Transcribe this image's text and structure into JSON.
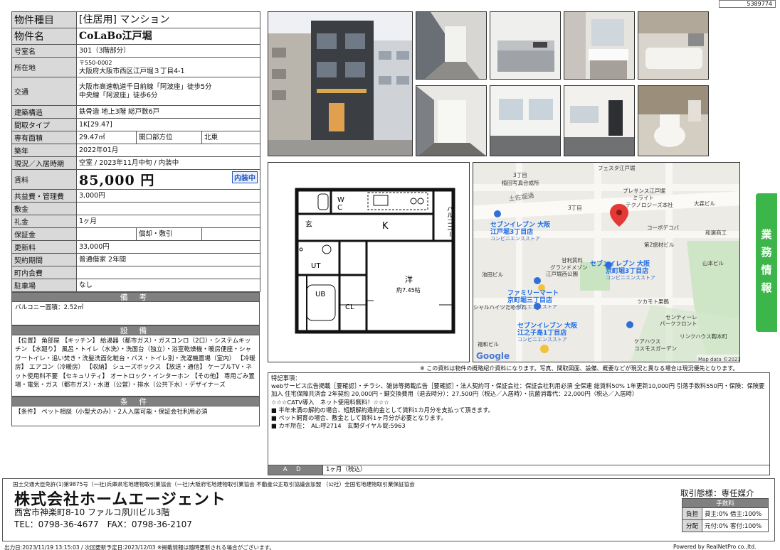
{
  "doc_id": "5389774",
  "spec": {
    "property_type": {
      "label": "物件種目",
      "value": "[住居用] マンション"
    },
    "property_name": {
      "label": "物件名",
      "value": "CoLaBo江戸堀"
    },
    "room_number": {
      "label": "号室名",
      "value": "301（3階部分）"
    },
    "location": {
      "label": "所在地",
      "postal": "〒550-0002",
      "value": "大阪府大阪市西区江戸堀３丁目4-1"
    },
    "transport": {
      "label": "交通",
      "line1": "大阪市高速軌道千日前線「阿波座」徒歩5分",
      "line2": "中央線「阿波座」徒歩6分"
    },
    "structure": {
      "label": "建築構造",
      "value": "鉄骨造 地上3階 総戸数6戸"
    },
    "layout_type": {
      "label": "間取タイプ",
      "value": "1K[29.47]"
    },
    "area": {
      "label": "専有面積",
      "value": "29.47㎡",
      "opening_label": "開口部方位",
      "opening_value": "北東"
    },
    "built": {
      "label": "築年",
      "value": "2022年01月"
    },
    "status": {
      "label": "現況／入居時期",
      "value": "空室 / 2023年11月中旬 / 内装中"
    },
    "rent": {
      "label": "賃料",
      "value": "85,000 円",
      "badge": "内装中"
    },
    "common_fee": {
      "label": "共益費・管理費",
      "value": "3,000円"
    },
    "deposit": {
      "label": "敷金",
      "value": ""
    },
    "key_money": {
      "label": "礼金",
      "value": "1ヶ月"
    },
    "guarantee": {
      "label": "保証金",
      "value": "",
      "shokyaku_label": "償却・敷引",
      "shokyaku_value": ""
    },
    "renewal": {
      "label": "更新料",
      "value": "33,000円"
    },
    "contract": {
      "label": "契約期間",
      "value": "普通借家 2年間"
    },
    "town_fee": {
      "label": "町内会費",
      "value": ""
    },
    "parking": {
      "label": "駐車場",
      "value": "なし"
    }
  },
  "notes": {
    "head": "備 考",
    "body": "バルコニー面積：2.52㎡"
  },
  "facilities": {
    "head": "設 備",
    "body": "【位置】 角部屋 【キッチン】 給湯器（都市ガス）・ガスコンロ（2口）・システムキッチン 【水廻り】 風呂・トイレ（水洗）・洗面台（独立）・浴室乾燥機・暖房便座・シャワートイレ・追い焚き・洗髪洗面化粧台・バス・トイレ別・洗濯機置場（室内） 【冷暖房】 エアコン（冷暖房） 【収納】 シューズボックス 【放送・通信】 ケーブルTV・ネット使用料不要 【セキュリティ】 オートロック・インターホン 【その他】 専用ごみ置場・電気・ガス（都市ガス）・水道（公営）・排水（公共下水）・デザイナーズ"
  },
  "conditions": {
    "head": "条 件",
    "body": "【条件】 ペット相談（小型犬のみ）・2人入居可能・保証会社利用必須"
  },
  "floorplan": {
    "wc": "W",
    "wc2": "C",
    "k": "K",
    "balcony": "バルコニー",
    "entrance": "玄",
    "ut": "UT",
    "ub": "UB",
    "cl": "CL",
    "western": "洋",
    "western_size": "約7.45帖"
  },
  "map": {
    "labels": {
      "festa": "フェスタ江戸堀",
      "chome3_a": "3丁目",
      "chome3_b": "3丁目",
      "uetsuki": "植田写真合成所",
      "tosabori": "土佐堀通",
      "presence": "プレサンス江戸堀",
      "mirait": "ミライト",
      "technologies": "テクノロジーズ本社",
      "daihin": "大森ビル",
      "seven1_a": "セブンイレブン 大阪",
      "seven1_b": "江戸堀3丁目店",
      "seven1_c": "コンビニエンスストア",
      "corbo": "コーボデコバ",
      "wako": "和選商工",
      "daini": "第2旅材ビル",
      "kanri": "甘利質料",
      "grand_a": "グランドメゾン",
      "grand_b": "江戸堀西公園",
      "seven2_a": "セブンイレブン 大阪",
      "seven2_b": "京町堀3丁目店",
      "seven2_c": "コンビニエンスストア",
      "yamamoto": "山本ビル",
      "ikeda": "池田ビル",
      "family_a": "ファミリーマート",
      "family_b": "京町堀三丁目店",
      "family_c": "コンビニエンスストア",
      "tsukaoto": "ツカモト果鶴",
      "shaleheights": "シャルハイツたそがれ",
      "center_a": "センティーレ",
      "center_b": "パークフロント",
      "seven3_a": "セブンイレブン 大阪",
      "seven3_b": "江之子島1丁目店",
      "seven3_c": "コンビニエンスストア",
      "linkhouse": "リンクハウス靱本町",
      "fukuwa": "福和ビル",
      "kepyhouse_a": "ケアハウス",
      "kepyhouse_b": "コスモスガーデン",
      "google": "Google",
      "mapdata": "Map data ©2021"
    }
  },
  "side_tab": [
    "業",
    "務",
    "情",
    "報"
  ],
  "disclaimer": "※ この資料は物件の概略紹介資料になります。写真、間取図面、設備、概要などが現況と異なる場合は現況優先となります。",
  "remarks": {
    "title": "特記事項：",
    "line1": "webサービス広告掲載［要確認］・チラシ、雑誌等掲載広告［要確認］・法人契約可・保証会社：保証会社利用必須 全保連 総賃料50% 1年更新10,000円 引落手数料550円・保険：保険要加入 住宅保障共済会 2年契約 20,000円・鍵交換費用（退去時分）：27,500円（税込／入居時）・抗菌消毒代：22,000円（税込／入居時）",
    "line2": "☆☆☆CATV導入　ネット使用料無料！☆☆☆",
    "line3": "■ 半年未満の解約の場合、短期解約違約金として賃料1カ月分を支払って頂きます。",
    "line4": "■ ペット飼育の場合、敷金として賃料1ヶ月分が必要となります。",
    "line5": "■ カギ所在：　AL:呼2714　玄関ダイヤル錠:5963",
    "ad_label": "ＡＤ",
    "ad_value": "1ヶ月（税込）"
  },
  "company": {
    "license": "国土交通大臣免許(1)第9875号（一社)兵庫県宅地建物取引業協会（一社)大阪府宅地建物取引業協会 不動産公正取引協議会加盟 （公社）全国宅地建物取引業保証協会",
    "name": "株式会社ホームエージェント",
    "address": "西宮市神楽町8-10 ファルコ夙川ビル3階",
    "tel": "TEL：0798-36-4677　FAX：0798-36-2107",
    "deal_type": "取引態様：専任媒介",
    "fee_head": "手数料",
    "fee_burden_label": "負担",
    "fee_burden_value": "貸主:0%  借主:100%",
    "fee_split_label": "分配",
    "fee_split_value": "元付:0%  客付:100%"
  },
  "footer": {
    "left": "出力日:2023/11/19 13:15:03 / 次回更新予定日:2023/12/03 ※掲載情報は随時更新される場合がございます。",
    "right": "Powered by RealNetPro co.,ltd."
  }
}
